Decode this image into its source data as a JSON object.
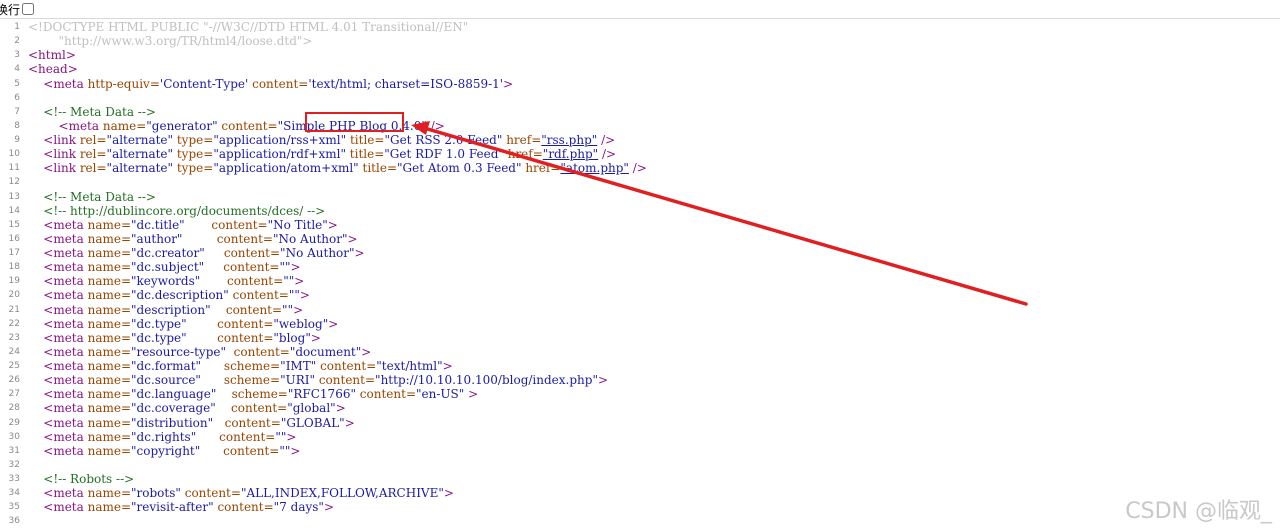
{
  "toolbar": {
    "wrap_label": "换行"
  },
  "lines": [
    {
      "n": "1",
      "segments": [
        {
          "c": "dt",
          "t": "<!DOCTYPE HTML PUBLIC \"-//W3C//DTD HTML 4.01 Transitional//EN\""
        }
      ]
    },
    {
      "n": "2",
      "segments": [
        {
          "c": "dt",
          "t": "        \"http://www.w3.org/TR/html4/loose.dtd\">"
        }
      ]
    },
    {
      "n": "3",
      "segments": [
        {
          "c": "tag",
          "t": "<html>"
        }
      ]
    },
    {
      "n": "4",
      "segments": [
        {
          "c": "tag",
          "t": "<head>"
        }
      ]
    },
    {
      "n": "5",
      "segments": [
        {
          "c": "tag",
          "t": "    <meta "
        },
        {
          "c": "attr",
          "t": "http-equiv="
        },
        {
          "c": "val",
          "t": "'Content-Type'"
        },
        {
          "c": "attr",
          "t": " content="
        },
        {
          "c": "val",
          "t": "'text/html; charset=ISO-8859-1'"
        },
        {
          "c": "tag",
          "t": ">"
        }
      ]
    },
    {
      "n": "6",
      "segments": [
        {
          "c": "",
          "t": ""
        }
      ]
    },
    {
      "n": "7",
      "segments": [
        {
          "c": "cmt",
          "t": "    <!-- Meta Data -->"
        }
      ]
    },
    {
      "n": "8",
      "segments": [
        {
          "c": "tag",
          "t": "        <meta "
        },
        {
          "c": "attr",
          "t": "name="
        },
        {
          "c": "val",
          "t": "\"generator\""
        },
        {
          "c": "attr",
          "t": " content="
        },
        {
          "c": "val",
          "t": "\"Simple PHP Blog 0.4.0\""
        },
        {
          "c": "tag",
          "t": " />"
        }
      ]
    },
    {
      "n": "9",
      "segments": [
        {
          "c": "tag",
          "t": "    <link "
        },
        {
          "c": "attr",
          "t": "rel="
        },
        {
          "c": "val",
          "t": "\"alternate\""
        },
        {
          "c": "attr",
          "t": " type="
        },
        {
          "c": "val",
          "t": "\"application/rss+xml\""
        },
        {
          "c": "attr",
          "t": " title="
        },
        {
          "c": "val",
          "t": "\"Get RSS 2.0 Feed\""
        },
        {
          "c": "attr",
          "t": " href="
        },
        {
          "c": "lnk",
          "t": "\"rss.php\""
        },
        {
          "c": "tag",
          "t": " />"
        }
      ]
    },
    {
      "n": "10",
      "segments": [
        {
          "c": "tag",
          "t": "    <link "
        },
        {
          "c": "attr",
          "t": "rel="
        },
        {
          "c": "val",
          "t": "\"alternate\""
        },
        {
          "c": "attr",
          "t": " type="
        },
        {
          "c": "val",
          "t": "\"application/rdf+xml\""
        },
        {
          "c": "attr",
          "t": " title="
        },
        {
          "c": "val",
          "t": "\"Get RDF 1.0 Feed\""
        },
        {
          "c": "attr",
          "t": " href="
        },
        {
          "c": "lnk",
          "t": "\"rdf.php\""
        },
        {
          "c": "tag",
          "t": " />"
        }
      ]
    },
    {
      "n": "11",
      "segments": [
        {
          "c": "tag",
          "t": "    <link "
        },
        {
          "c": "attr",
          "t": "rel="
        },
        {
          "c": "val",
          "t": "\"alternate\""
        },
        {
          "c": "attr",
          "t": " type="
        },
        {
          "c": "val",
          "t": "\"application/atom+xml\""
        },
        {
          "c": "attr",
          "t": " title="
        },
        {
          "c": "val",
          "t": "\"Get Atom 0.3 Feed\""
        },
        {
          "c": "attr",
          "t": " href="
        },
        {
          "c": "lnk",
          "t": "\"atom.php\""
        },
        {
          "c": "tag",
          "t": " />"
        }
      ]
    },
    {
      "n": "12",
      "segments": [
        {
          "c": "",
          "t": ""
        }
      ]
    },
    {
      "n": "13",
      "segments": [
        {
          "c": "cmt",
          "t": "    <!-- Meta Data -->"
        }
      ]
    },
    {
      "n": "14",
      "segments": [
        {
          "c": "cmt",
          "t": "    <!-- http://dublincore.org/documents/dces/ -->"
        }
      ]
    },
    {
      "n": "15",
      "segments": [
        {
          "c": "tag",
          "t": "    <meta "
        },
        {
          "c": "attr",
          "t": "name="
        },
        {
          "c": "val",
          "t": "\"dc.title\"       "
        },
        {
          "c": "attr",
          "t": "content="
        },
        {
          "c": "val",
          "t": "\"No Title\""
        },
        {
          "c": "tag",
          "t": ">"
        }
      ]
    },
    {
      "n": "16",
      "segments": [
        {
          "c": "tag",
          "t": "    <meta "
        },
        {
          "c": "attr",
          "t": "name="
        },
        {
          "c": "val",
          "t": "\"author\"         "
        },
        {
          "c": "attr",
          "t": "content="
        },
        {
          "c": "val",
          "t": "\"No Author\""
        },
        {
          "c": "tag",
          "t": ">"
        }
      ]
    },
    {
      "n": "17",
      "segments": [
        {
          "c": "tag",
          "t": "    <meta "
        },
        {
          "c": "attr",
          "t": "name="
        },
        {
          "c": "val",
          "t": "\"dc.creator\"     "
        },
        {
          "c": "attr",
          "t": "content="
        },
        {
          "c": "val",
          "t": "\"No Author\""
        },
        {
          "c": "tag",
          "t": ">"
        }
      ]
    },
    {
      "n": "18",
      "segments": [
        {
          "c": "tag",
          "t": "    <meta "
        },
        {
          "c": "attr",
          "t": "name="
        },
        {
          "c": "val",
          "t": "\"dc.subject\"     "
        },
        {
          "c": "attr",
          "t": "content="
        },
        {
          "c": "val",
          "t": "\"\""
        },
        {
          "c": "tag",
          "t": ">"
        }
      ]
    },
    {
      "n": "19",
      "segments": [
        {
          "c": "tag",
          "t": "    <meta "
        },
        {
          "c": "attr",
          "t": "name="
        },
        {
          "c": "val",
          "t": "\"keywords\"       "
        },
        {
          "c": "attr",
          "t": "content="
        },
        {
          "c": "val",
          "t": "\"\""
        },
        {
          "c": "tag",
          "t": ">"
        }
      ]
    },
    {
      "n": "20",
      "segments": [
        {
          "c": "tag",
          "t": "    <meta "
        },
        {
          "c": "attr",
          "t": "name="
        },
        {
          "c": "val",
          "t": "\"dc.description\" "
        },
        {
          "c": "attr",
          "t": "content="
        },
        {
          "c": "val",
          "t": "\"\""
        },
        {
          "c": "tag",
          "t": ">"
        }
      ]
    },
    {
      "n": "21",
      "segments": [
        {
          "c": "tag",
          "t": "    <meta "
        },
        {
          "c": "attr",
          "t": "name="
        },
        {
          "c": "val",
          "t": "\"description\"    "
        },
        {
          "c": "attr",
          "t": "content="
        },
        {
          "c": "val",
          "t": "\"\""
        },
        {
          "c": "tag",
          "t": ">"
        }
      ]
    },
    {
      "n": "22",
      "segments": [
        {
          "c": "tag",
          "t": "    <meta "
        },
        {
          "c": "attr",
          "t": "name="
        },
        {
          "c": "val",
          "t": "\"dc.type\"        "
        },
        {
          "c": "attr",
          "t": "content="
        },
        {
          "c": "val",
          "t": "\"weblog\""
        },
        {
          "c": "tag",
          "t": ">"
        }
      ]
    },
    {
      "n": "23",
      "segments": [
        {
          "c": "tag",
          "t": "    <meta "
        },
        {
          "c": "attr",
          "t": "name="
        },
        {
          "c": "val",
          "t": "\"dc.type\"        "
        },
        {
          "c": "attr",
          "t": "content="
        },
        {
          "c": "val",
          "t": "\"blog\""
        },
        {
          "c": "tag",
          "t": ">"
        }
      ]
    },
    {
      "n": "24",
      "segments": [
        {
          "c": "tag",
          "t": "    <meta "
        },
        {
          "c": "attr",
          "t": "name="
        },
        {
          "c": "val",
          "t": "\"resource-type\"  "
        },
        {
          "c": "attr",
          "t": "content="
        },
        {
          "c": "val",
          "t": "\"document\""
        },
        {
          "c": "tag",
          "t": ">"
        }
      ]
    },
    {
      "n": "25",
      "segments": [
        {
          "c": "tag",
          "t": "    <meta "
        },
        {
          "c": "attr",
          "t": "name="
        },
        {
          "c": "val",
          "t": "\"dc.format\"      "
        },
        {
          "c": "attr",
          "t": "scheme="
        },
        {
          "c": "val",
          "t": "\"IMT\""
        },
        {
          "c": "attr",
          "t": " content="
        },
        {
          "c": "val",
          "t": "\"text/html\""
        },
        {
          "c": "tag",
          "t": ">"
        }
      ]
    },
    {
      "n": "26",
      "segments": [
        {
          "c": "tag",
          "t": "    <meta "
        },
        {
          "c": "attr",
          "t": "name="
        },
        {
          "c": "val",
          "t": "\"dc.source\"      "
        },
        {
          "c": "attr",
          "t": "scheme="
        },
        {
          "c": "val",
          "t": "\"URI\""
        },
        {
          "c": "attr",
          "t": " content="
        },
        {
          "c": "val",
          "t": "\"http://10.10.10.100/blog/index.php\""
        },
        {
          "c": "tag",
          "t": ">"
        }
      ]
    },
    {
      "n": "27",
      "segments": [
        {
          "c": "tag",
          "t": "    <meta "
        },
        {
          "c": "attr",
          "t": "name="
        },
        {
          "c": "val",
          "t": "\"dc.language\"    "
        },
        {
          "c": "attr",
          "t": "scheme="
        },
        {
          "c": "val",
          "t": "\"RFC1766\""
        },
        {
          "c": "attr",
          "t": " content="
        },
        {
          "c": "val",
          "t": "\"en-US\""
        },
        {
          "c": "tag",
          "t": " >"
        }
      ]
    },
    {
      "n": "28",
      "segments": [
        {
          "c": "tag",
          "t": "    <meta "
        },
        {
          "c": "attr",
          "t": "name="
        },
        {
          "c": "val",
          "t": "\"dc.coverage\"    "
        },
        {
          "c": "attr",
          "t": "content="
        },
        {
          "c": "val",
          "t": "\"global\""
        },
        {
          "c": "tag",
          "t": ">"
        }
      ]
    },
    {
      "n": "29",
      "segments": [
        {
          "c": "tag",
          "t": "    <meta "
        },
        {
          "c": "attr",
          "t": "name="
        },
        {
          "c": "val",
          "t": "\"distribution\"   "
        },
        {
          "c": "attr",
          "t": "content="
        },
        {
          "c": "val",
          "t": "\"GLOBAL\""
        },
        {
          "c": "tag",
          "t": ">"
        }
      ]
    },
    {
      "n": "30",
      "segments": [
        {
          "c": "tag",
          "t": "    <meta "
        },
        {
          "c": "attr",
          "t": "name="
        },
        {
          "c": "val",
          "t": "\"dc.rights\"      "
        },
        {
          "c": "attr",
          "t": "content="
        },
        {
          "c": "val",
          "t": "\"\""
        },
        {
          "c": "tag",
          "t": ">"
        }
      ]
    },
    {
      "n": "31",
      "segments": [
        {
          "c": "tag",
          "t": "    <meta "
        },
        {
          "c": "attr",
          "t": "name="
        },
        {
          "c": "val",
          "t": "\"copyright\"      "
        },
        {
          "c": "attr",
          "t": "content="
        },
        {
          "c": "val",
          "t": "\"\""
        },
        {
          "c": "tag",
          "t": ">"
        }
      ]
    },
    {
      "n": "32",
      "segments": [
        {
          "c": "",
          "t": ""
        }
      ]
    },
    {
      "n": "33",
      "segments": [
        {
          "c": "cmt",
          "t": "    <!-- Robots -->"
        }
      ]
    },
    {
      "n": "34",
      "segments": [
        {
          "c": "tag",
          "t": "    <meta "
        },
        {
          "c": "attr",
          "t": "name="
        },
        {
          "c": "val",
          "t": "\"robots\""
        },
        {
          "c": "attr",
          "t": " content="
        },
        {
          "c": "val",
          "t": "\"ALL,INDEX,FOLLOW,ARCHIVE\""
        },
        {
          "c": "tag",
          "t": ">"
        }
      ]
    },
    {
      "n": "35",
      "segments": [
        {
          "c": "tag",
          "t": "    <meta "
        },
        {
          "c": "attr",
          "t": "name="
        },
        {
          "c": "val",
          "t": "\"revisit-after\""
        },
        {
          "c": "attr",
          "t": " content="
        },
        {
          "c": "val",
          "t": "\"7 days\""
        },
        {
          "c": "tag",
          "t": ">"
        }
      ]
    },
    {
      "n": "36",
      "segments": [
        {
          "c": "",
          "t": ""
        }
      ]
    }
  ],
  "annotation": {
    "color": "#e02020"
  },
  "watermark": {
    "text": "CSDN @临观_"
  }
}
